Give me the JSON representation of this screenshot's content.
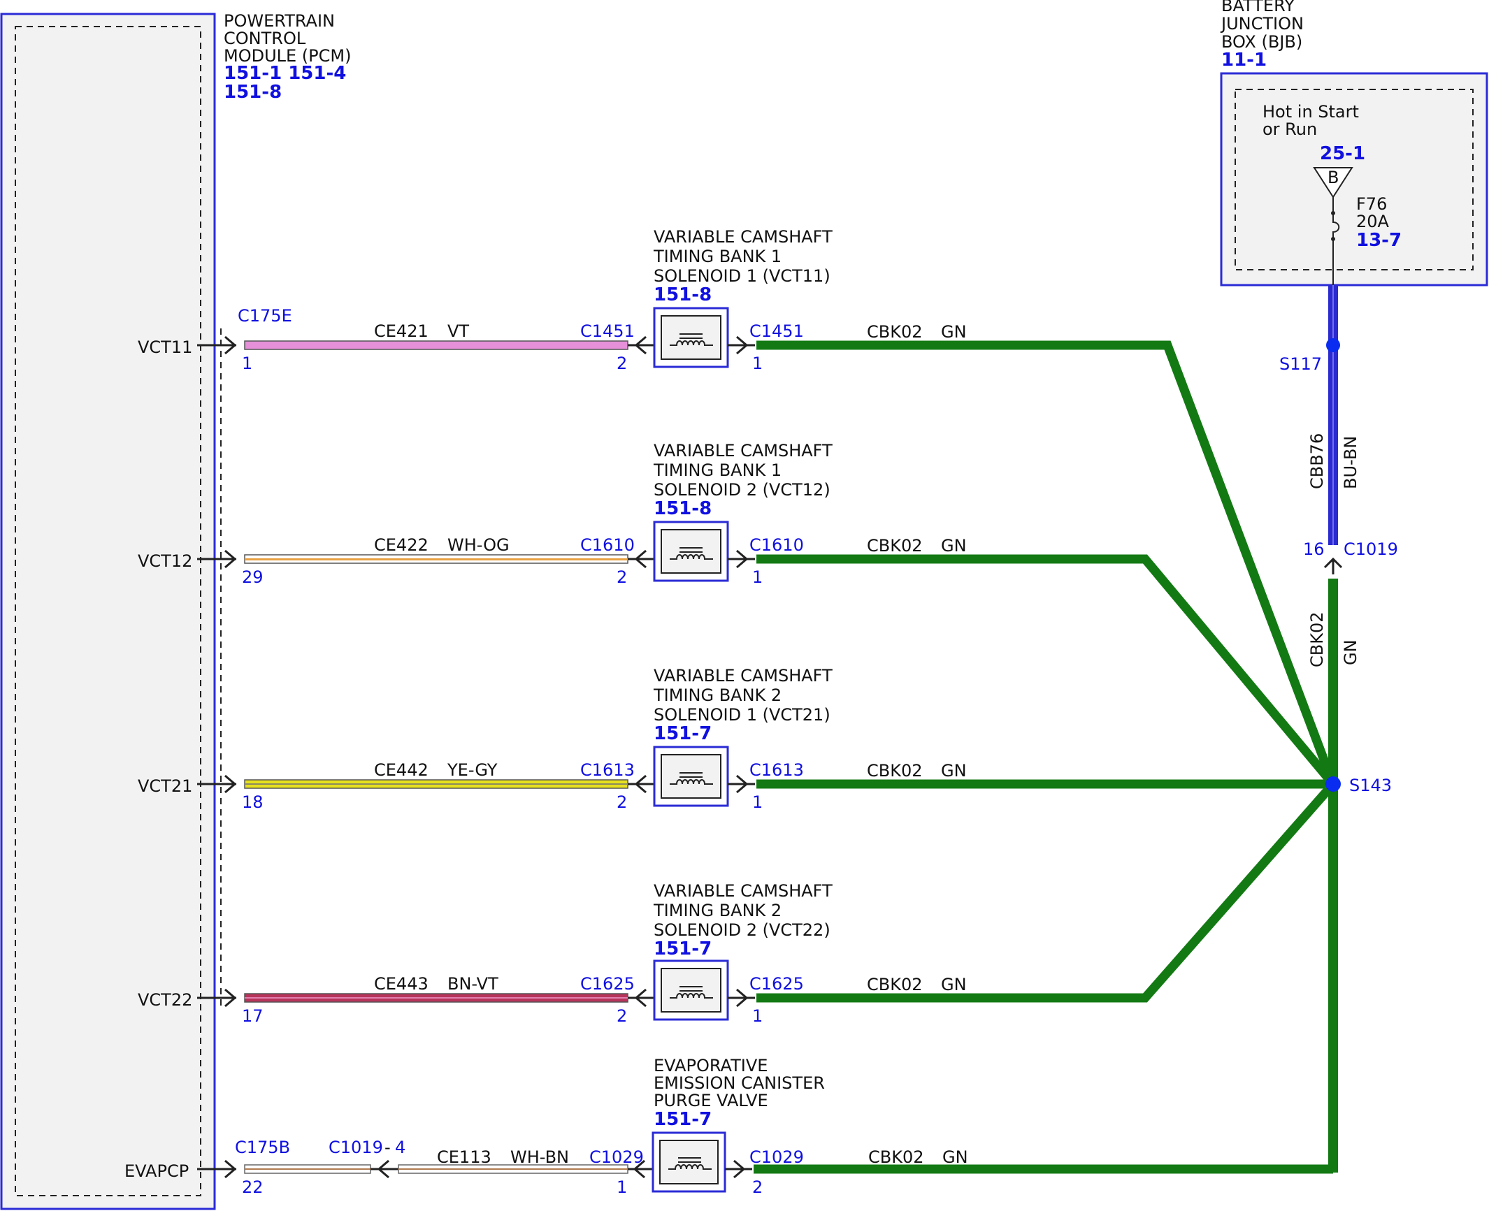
{
  "pcm": {
    "label_lines": [
      "POWERTRAIN",
      "CONTROL",
      "MODULE (PCM)"
    ],
    "refs": [
      "151-1 151-4",
      "151-8"
    ]
  },
  "bjb": {
    "label_lines": [
      "BATTERY",
      "JUNCTION",
      "BOX (BJB)"
    ],
    "ref": "11-1",
    "hot_lines": [
      "Hot in Start",
      "or Run"
    ],
    "bus_ref": "25-1",
    "bus_letter": "B",
    "fuse_name": "F76",
    "fuse_rating": "20A",
    "fuse_ref": "13-7"
  },
  "feed": {
    "splice_top": "S117",
    "circuit": "CBB76",
    "color": "BU-BN",
    "pin": "16",
    "connector": "C1019",
    "ground_circuit": "CBK02",
    "ground_color": "GN",
    "splice_main": "S143"
  },
  "rows": [
    {
      "pcm_pin_name": "VCT11",
      "pcm_connector": "C175E",
      "pcm_pin": "1",
      "circuit": "CE421",
      "color_code": "VT",
      "comp_connector": "C1451",
      "comp_pin_in": "2",
      "comp_pin_out": "1",
      "comp_lines": [
        "VARIABLE CAMSHAFT",
        "TIMING BANK 1",
        "SOLENOID 1 (VCT11)"
      ],
      "comp_ref": "151-8",
      "gnd_circuit": "CBK02",
      "gnd_color": "GN",
      "wire_fill": "#e590d8"
    },
    {
      "pcm_pin_name": "VCT12",
      "pcm_connector": "",
      "pcm_pin": "29",
      "circuit": "CE422",
      "color_code": "WH-OG",
      "comp_connector": "C1610",
      "comp_pin_in": "2",
      "comp_pin_out": "1",
      "comp_lines": [
        "VARIABLE CAMSHAFT",
        "TIMING BANK 1",
        "SOLENOID 2 (VCT12)"
      ],
      "comp_ref": "151-8",
      "gnd_circuit": "CBK02",
      "gnd_color": "GN",
      "wire_fill": "#f4d9b0"
    },
    {
      "pcm_pin_name": "VCT21",
      "pcm_connector": "",
      "pcm_pin": "18",
      "circuit": "CE442",
      "color_code": "YE-GY",
      "comp_connector": "C1613",
      "comp_pin_in": "2",
      "comp_pin_out": "1",
      "comp_lines": [
        "VARIABLE CAMSHAFT",
        "TIMING BANK 2",
        "SOLENOID 1 (VCT21)"
      ],
      "comp_ref": "151-7",
      "gnd_circuit": "CBK02",
      "gnd_color": "GN",
      "wire_fill": "#e6e020"
    },
    {
      "pcm_pin_name": "VCT22",
      "pcm_connector": "",
      "pcm_pin": "17",
      "circuit": "CE443",
      "color_code": "BN-VT",
      "comp_connector": "C1625",
      "comp_pin_in": "2",
      "comp_pin_out": "1",
      "comp_lines": [
        "VARIABLE CAMSHAFT",
        "TIMING BANK 2",
        "SOLENOID 2 (VCT22)"
      ],
      "comp_ref": "151-7",
      "gnd_circuit": "CBK02",
      "gnd_color": "GN",
      "wire_fill": "#b8345a"
    }
  ],
  "evap": {
    "pcm_pin_name": "EVAPCP",
    "pcm_connector": "C175B",
    "pcm_pin": "22",
    "inline_connector": "C1019",
    "inline_pin": "4",
    "circuit": "CE113",
    "color_code": "WH-BN",
    "comp_connector": "C1029",
    "comp_pin_in": "1",
    "comp_pin_out": "2",
    "comp_lines": [
      "EVAPORATIVE",
      "EMISSION CANISTER",
      "PURGE VALVE"
    ],
    "comp_ref": "151-7",
    "gnd_circuit": "CBK02",
    "gnd_color": "GN",
    "wire_fill": "#f2f2f2"
  },
  "colors": {
    "ground_green": "#137a13",
    "blue_outline": "#2b2bd6",
    "feed_blue": "#2a2ad0",
    "module_fill": "#f2f2f2"
  }
}
